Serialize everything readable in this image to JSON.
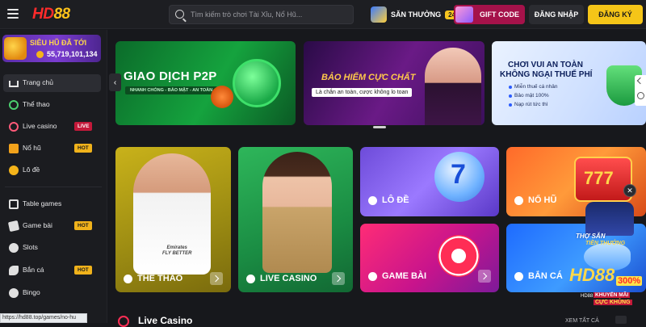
{
  "header": {
    "logo_part1": "HD",
    "logo_part2": "88",
    "search_placeholder": "Tìm kiếm trò chơi Tài Xỉu, Nổ Hũ...",
    "reward_label": "SĂN THƯỞNG",
    "reward_count": "24",
    "gift_label": "GIFT CODE",
    "login_label": "ĐĂNG NHẬP",
    "register_label": "ĐĂNG KÝ",
    "colors": {
      "register": "#f5c518",
      "gift": "#a5124a"
    }
  },
  "sidebar": {
    "jackpot_title": "SIÊU HŨ ĐÃ TỚI",
    "jackpot_amount": "55,719,101,134",
    "items": [
      {
        "label": "Trang chủ",
        "icon": "home-icon",
        "active": true,
        "badge": ""
      },
      {
        "label": "Thể thao",
        "icon": "soccer-ball-icon",
        "badge": ""
      },
      {
        "label": "Live casino",
        "icon": "live-casino-icon",
        "badge": "LIVE"
      },
      {
        "label": "Nổ hũ",
        "icon": "slot-machine-icon",
        "badge": "HOT"
      },
      {
        "label": "Lô đề",
        "icon": "lottery-ball-icon",
        "badge": ""
      },
      {
        "label": "Table games",
        "icon": "table-games-icon",
        "badge": ""
      },
      {
        "label": "Game bài",
        "icon": "playing-cards-icon",
        "badge": "HOT"
      },
      {
        "label": "Slots",
        "icon": "slots-icon",
        "badge": ""
      },
      {
        "label": "Bắn cá",
        "icon": "fish-icon",
        "badge": "HOT"
      },
      {
        "label": "Bingo",
        "icon": "bingo-icon",
        "badge": ""
      }
    ],
    "status_url": "https://hd88.top/games/no-hu"
  },
  "banners": [
    {
      "title": "GIAO DỊCH P2P",
      "subtitle": "NHANH CHÓNG - BẢO MẬT - AN TOÀN"
    },
    {
      "title": "BẢO HIỂM CỰC CHẤT",
      "subtitle": "Là chắn an toàn, cược không lo toan"
    },
    {
      "title_line1": "CHƠI VUI AN TOÀN",
      "title_line2": "KHÔNG NGẠI THUẾ PHÍ",
      "bullets": [
        "Miễn thuế cá nhân",
        "Bảo mật 100%",
        "Nạp rút tức thì"
      ]
    }
  ],
  "categories": [
    {
      "label": "THỂ THAO",
      "jersey": "Emirates\nFLY BETTER"
    },
    {
      "label": "LIVE CASINO"
    },
    {
      "label": "LÔ ĐỀ",
      "number": "7"
    },
    {
      "label": "NỔ HŨ",
      "number": "777"
    },
    {
      "label": "GAME BÀI"
    },
    {
      "label": "BẮN CÁ"
    }
  ],
  "promo": {
    "line1": "THỢ SĂN",
    "line2": "TIỀN THƯỞNG",
    "logo": "HD88",
    "percent": "300%",
    "small": "HD88",
    "caption1": "KHUYẾN MÃI",
    "caption2": "CỰC KHỦNG"
  },
  "section": {
    "title": "Live Casino",
    "see_all": "XEM TẤT CẢ"
  }
}
